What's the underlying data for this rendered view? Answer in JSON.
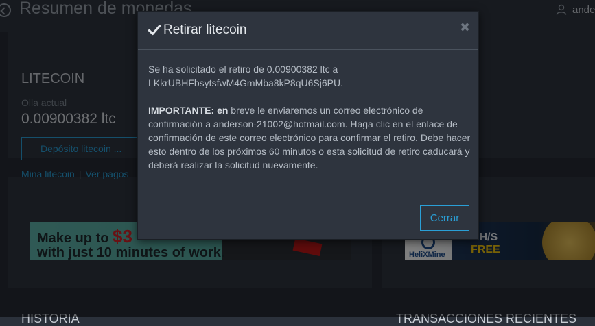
{
  "header": {
    "title": "Resumen de monedas",
    "user_name": "ande"
  },
  "coin_panel": {
    "title": "LITECOIN",
    "balance_label": "Olla actual",
    "balance_value": "0.00900382 ltc",
    "deposit_button": "Depósito litecoin ...",
    "link_mine": "Mina litecoin",
    "link_separator": "|",
    "link_payments": "Ver pagos"
  },
  "ad_left": {
    "line1_prefix": "Make up to",
    "line1_highlight": "$3",
    "line2": "with just 10 minutes of work."
  },
  "ad_right": {
    "logo": "HeliXMine",
    "line1": "GH/S",
    "line2": "FREE"
  },
  "sections": {
    "history": "HISTORIA",
    "transactions": "TRANSACCIONES RECIENTES"
  },
  "modal": {
    "title": "Retirar litecoin",
    "close_symbol": "✖",
    "message1": "Se ha solicitado el retiro de 0.00900382 ltc a LKkrUBHFbsytsfwM4GmMba8kP8qU6Sj6PU.",
    "important_label": "IMPORTANTE: en",
    "message2": " breve le enviaremos un correo electrónico de confirmación a anderson-21002@hotmail.com. Haga clic en el enlace de confirmación de este correo electrónico para confirmar el retiro. Debe hacer esto dentro de los próximos 60 minutos o esta solicitud de retiro caducará y deberá realizar la solicitud nuevamente.",
    "close_button": "Cerrar"
  },
  "colors": {
    "accent": "#2a9fd6",
    "background": "#2b313b",
    "panel": "#2e343e"
  },
  "icons": [
    "back-icon",
    "user-icon",
    "check-icon",
    "close-icon"
  ]
}
